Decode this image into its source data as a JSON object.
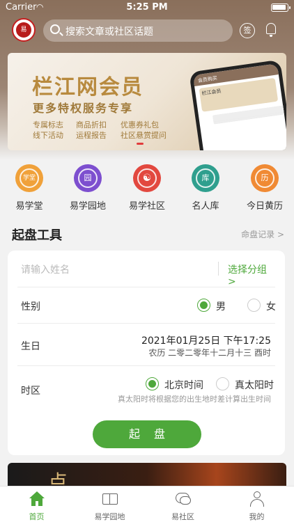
{
  "status_bar": {
    "carrier": "Carrier",
    "time": "5:25 PM"
  },
  "header": {
    "logo_text": "易",
    "search_placeholder": "搜索文章或社区话题",
    "sign_label": "签"
  },
  "banner": {
    "title": "栏江网会员",
    "subtitle": "更多特权服务专享",
    "features": [
      [
        "专属标志",
        "线下活动"
      ],
      [
        "商品折扣",
        "运程报告"
      ],
      [
        "优惠券礼包",
        "社区悬赏提问"
      ]
    ],
    "phone_header": "会员购买",
    "phone_card": "栏江会员",
    "phone_row": "选择开通套餐"
  },
  "quick_links": [
    {
      "label": "易学堂",
      "glyph": "学堂",
      "color": "#f0a13a"
    },
    {
      "label": "易学园地",
      "glyph": "园",
      "color": "#7d4fcf"
    },
    {
      "label": "易学社区",
      "glyph": "☯",
      "color": "#e2483f"
    },
    {
      "label": "名人库",
      "glyph": "库",
      "color": "#2f9f8e"
    },
    {
      "label": "今日黄历",
      "glyph": "历",
      "color": "#f08a34"
    }
  ],
  "tools_section": {
    "title": "起盘工具",
    "history_link": "命盘记录 >"
  },
  "form": {
    "name_placeholder": "请输入姓名",
    "group_link": "选择分组 >",
    "gender_label": "性别",
    "gender_options": [
      "男",
      "女"
    ],
    "gender_selected": "男",
    "birth_label": "生日",
    "birth_solar": "2021年01月25日 下午17:25",
    "birth_lunar": "农历 二零二零年十二月十三 酉时",
    "timezone_label": "时区",
    "timezone_options": [
      "北京时间",
      "真太阳时"
    ],
    "timezone_selected": "北京时间",
    "timezone_hint": "真太阳时将根据您的出生地时差计算出生时间",
    "start_button": "起盘"
  },
  "article_preview": {
    "glyph": "点"
  },
  "tab_bar": [
    {
      "label": "首页",
      "icon": "home-icon",
      "active": true
    },
    {
      "label": "易学园地",
      "icon": "book-icon",
      "active": false
    },
    {
      "label": "易社区",
      "icon": "chat-icon",
      "active": false
    },
    {
      "label": "我的",
      "icon": "user-icon",
      "active": false
    }
  ],
  "colors": {
    "accent": "#4ea83b",
    "header_brown": "#8a6f5b"
  }
}
